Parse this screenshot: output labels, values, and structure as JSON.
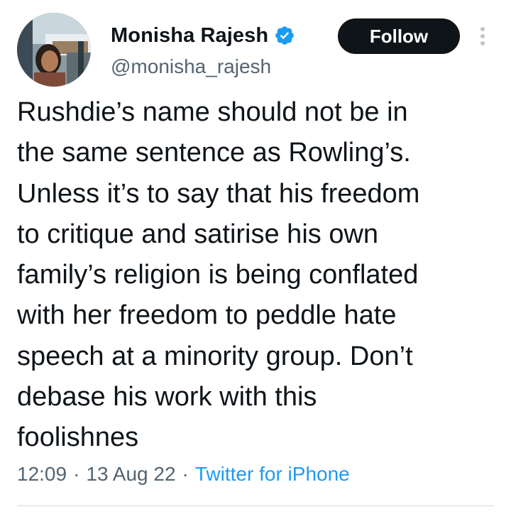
{
  "author": {
    "display_name": "Monisha Rajesh",
    "handle": "@monisha_rajesh",
    "verified": true
  },
  "follow_button": {
    "label": "Follow"
  },
  "tweet": {
    "text": "Rushdie’s name should not be in\nthe same sentence as Rowling’s.\nUnless it’s to say that his freedom\nto critique and satirise his own\nfamily’s religion is being conflated\nwith her freedom to peddle hate\nspeech at a minority group. Don’t\ndebase his work with this\nfoolishnes",
    "time": "12:09",
    "separator": "·",
    "date": "13 Aug 22",
    "source": "Twitter for iPhone"
  },
  "colors": {
    "text_primary": "#0f1419",
    "text_secondary": "#536471",
    "accent_blue": "#1d9bf0",
    "follow_bg": "#0f1419",
    "divider": "#cfd9de"
  },
  "icons": {
    "verified": "verified-badge-icon",
    "more": "more-vertical-icon"
  }
}
